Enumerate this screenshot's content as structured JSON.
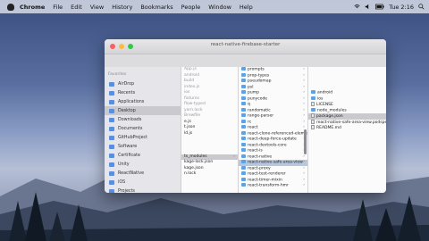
{
  "menubar": {
    "app": "Chrome",
    "items": [
      "File",
      "Edit",
      "View",
      "History",
      "Bookmarks",
      "People",
      "Window",
      "Help"
    ],
    "clock": "Tue 2:16"
  },
  "window": {
    "title": "react-native-firebase-starter"
  },
  "sidebar": {
    "heading": "Favorites",
    "items": [
      {
        "label": "AirDrop",
        "icon": "airdrop-icon"
      },
      {
        "label": "Recents",
        "icon": "clock-icon"
      },
      {
        "label": "Applications",
        "icon": "applications-icon"
      },
      {
        "label": "Desktop",
        "icon": "desktop-icon",
        "selected": true
      },
      {
        "label": "Downloads",
        "icon": "downloads-icon"
      },
      {
        "label": "Documents",
        "icon": "documents-icon"
      },
      {
        "label": "GitHubProject",
        "icon": "folder-icon"
      },
      {
        "label": "Software",
        "icon": "folder-icon"
      },
      {
        "label": "Certificate",
        "icon": "folder-icon"
      },
      {
        "label": "Unity",
        "icon": "folder-icon"
      },
      {
        "label": "ReactNative",
        "icon": "folder-icon"
      },
      {
        "label": "iOS",
        "icon": "folder-icon"
      },
      {
        "label": "Projects",
        "icon": "folder-icon"
      }
    ]
  },
  "col1": [
    {
      "label": "App.js",
      "dim": true
    },
    {
      "label": "android",
      "dim": true
    },
    {
      "label": "build",
      "dim": true
    },
    {
      "label": "index.js",
      "dim": true
    },
    {
      "label": "ios",
      "dim": true
    },
    {
      "label": "fixtures",
      "dim": true
    },
    {
      "label": "flow-typed",
      "dim": true
    },
    {
      "label": "yarn.lock",
      "dim": true
    },
    {
      "label": "Brewfile",
      "dim": true
    },
    {
      "label": "e.js",
      "dim": false
    },
    {
      "label": "t.json",
      "dim": false
    },
    {
      "label": "ld.js",
      "dim": false
    },
    {
      "label": "",
      "dim": false
    },
    {
      "label": "",
      "dim": false
    },
    {
      "label": "",
      "dim": false
    },
    {
      "label": "ts_modules",
      "dim": false,
      "selected": true
    },
    {
      "label": "kage-lock.json",
      "dim": false
    },
    {
      "label": "kage.json",
      "dim": false
    },
    {
      "label": "n.lock",
      "dim": false
    }
  ],
  "col2": [
    "prompts",
    "prop-types",
    "pseudomap",
    "psl",
    "pump",
    "punycode",
    "q",
    "randomatic",
    "range-parser",
    "rc",
    "react",
    "react-clone-referenced-element",
    "react-deep-force-update",
    "react-devtools-core",
    "react-is",
    "react-native",
    "react-native-safe-area-view",
    "react-proxy",
    "react-test-renderer",
    "react-timer-mixin",
    "react-transform-hmr"
  ],
  "col2_highlight": "react-native-safe-area-view",
  "col3": [
    {
      "label": "",
      "dim": true
    },
    {
      "label": "",
      "dim": true
    },
    {
      "label": "",
      "dim": true
    },
    {
      "label": "",
      "dim": true
    },
    {
      "label": "android",
      "dim": false,
      "folder": true
    },
    {
      "label": "ios",
      "dim": false,
      "folder": true
    },
    {
      "label": "LICENSE",
      "dim": false
    },
    {
      "label": "node_modules",
      "dim": false,
      "folder": true
    },
    {
      "label": "package.json",
      "dim": false,
      "selected": true
    },
    {
      "label": "react-native-safe-area-view.podspec",
      "dim": false
    },
    {
      "label": "README.md",
      "dim": false
    }
  ]
}
